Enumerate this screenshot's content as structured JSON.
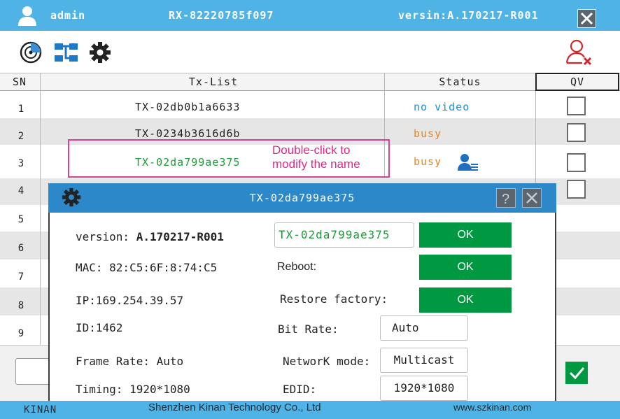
{
  "header": {
    "user": "admin",
    "device_id": "RX-82220785f097",
    "version": "versin:A.170217-R001"
  },
  "table": {
    "col_sn": "SN",
    "col_txlist": "Tx-List",
    "col_status": "Status",
    "col_qv": "QV",
    "rows": [
      {
        "sn": "1",
        "tx": "TX-02db0b1a6633",
        "status": "no video"
      },
      {
        "sn": "2",
        "tx": "TX-0234b3616d6b",
        "status": "busy"
      },
      {
        "sn": "3",
        "tx": "TX-02da799ae375",
        "status": "busy"
      },
      {
        "sn": "4",
        "tx": "",
        "status": ""
      },
      {
        "sn": "5",
        "tx": "",
        "status": ""
      },
      {
        "sn": "6",
        "tx": "",
        "status": ""
      },
      {
        "sn": "7",
        "tx": "",
        "status": ""
      },
      {
        "sn": "8",
        "tx": "",
        "status": ""
      },
      {
        "sn": "9",
        "tx": "",
        "status": ""
      }
    ]
  },
  "hint": {
    "line1": "Double-click to",
    "line2": "modify the name"
  },
  "dialog": {
    "title": "TX-02da799ae375",
    "version_label": "version: ",
    "version_value": "A.170217-R001",
    "mac": "MAC: 82:C5:6F:8:74:C5",
    "ip": "IP:169.254.39.57",
    "id": "ID:1462",
    "frame_rate": "Frame Rate: Auto",
    "timing": "Timing: 1920*1080",
    "name_value": "TX-02da799ae375",
    "ok1": "OK",
    "reboot": "Reboot:",
    "ok2": "OK",
    "restore": "Restore factory:",
    "ok3": "OK",
    "bit_rate_label": "Bit Rate:",
    "bit_rate_value": "Auto",
    "network_label": "NetworK mode:",
    "network_value": "Multicast",
    "edid_label": "EDID:",
    "edid_value": "1920*1080"
  },
  "footer": {
    "left": "KINAN",
    "company": "Shenzhen Kinan Technology Co., Ltd",
    "website": "www.szkinan.com"
  },
  "colors": {
    "topbar": "#4fb3e6",
    "dialog_title": "#2d88c9",
    "ok_green": "#009942",
    "status_blue": "#1a8fd6",
    "status_orange": "#e8852a",
    "tx_green": "#1f9a3a",
    "hint_pink": "#d8419a"
  }
}
